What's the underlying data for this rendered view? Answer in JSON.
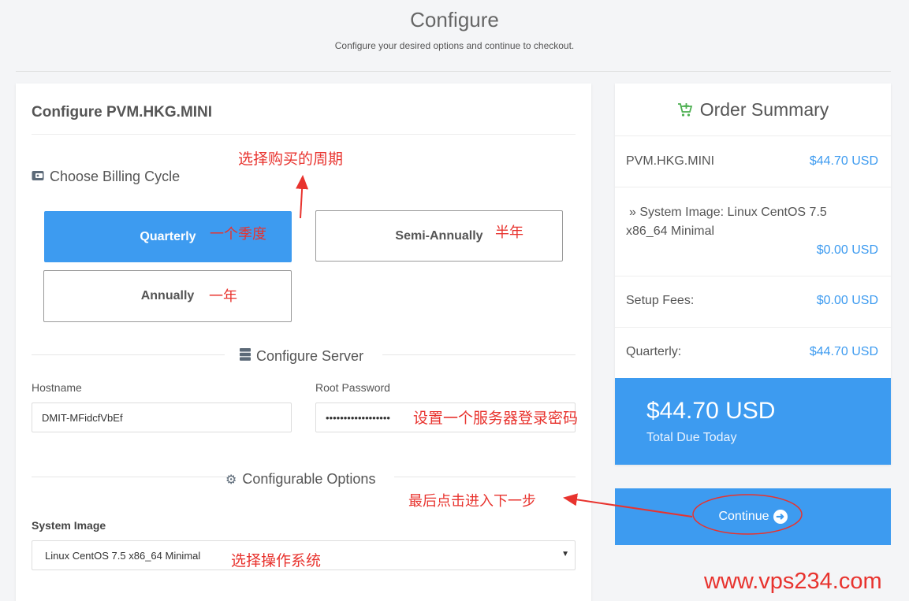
{
  "page": {
    "title": "Configure",
    "subtitle": "Configure your desired options and continue to checkout."
  },
  "config": {
    "title": "Configure PVM.HKG.MINI",
    "billing_heading": "Choose Billing Cycle",
    "billing_options": [
      "Quarterly",
      "Semi-Annually",
      "Annually"
    ],
    "selected_billing": "Quarterly",
    "server_heading": "Configure Server",
    "hostname_label": "Hostname",
    "hostname_value": "DMIT-MFidcfVbEf",
    "password_label": "Root Password",
    "password_value": "••••••••••••••••••",
    "options_heading": "Configurable Options",
    "system_image_label": "System Image",
    "system_image_value": "Linux CentOS 7.5 x86_64 Minimal"
  },
  "summary": {
    "title": "Order Summary",
    "product_name": "PVM.HKG.MINI",
    "product_price": "$44.70 USD",
    "addon_line1": "» System Image: Linux CentOS 7.5",
    "addon_line2": "x86_64 Minimal",
    "addon_price": "$0.00 USD",
    "setup_label": "Setup Fees:",
    "setup_price": "$0.00 USD",
    "cycle_label": "Quarterly:",
    "cycle_price": "$44.70 USD",
    "total_amount": "$44.70 USD",
    "total_label": "Total Due Today"
  },
  "actions": {
    "continue_label": "Continue"
  },
  "annotations": {
    "choose_cycle": "选择购买的周期",
    "quarterly": "一个季度",
    "semi_annually": "半年",
    "annually": "一年",
    "set_password": "设置一个服务器登录密码",
    "click_next": "最后点击进入下一步",
    "choose_os": "选择操作系统"
  },
  "watermark": "www.vps234.com",
  "colors": {
    "accent": "#3d9bf0",
    "annotation": "#e8332e",
    "cart_icon": "#4caf50"
  },
  "icons": [
    "wallet-icon",
    "server-icon",
    "gear-icon",
    "cart-plus-icon",
    "arrow-circle-right-icon",
    "chevron-down-icon"
  ]
}
